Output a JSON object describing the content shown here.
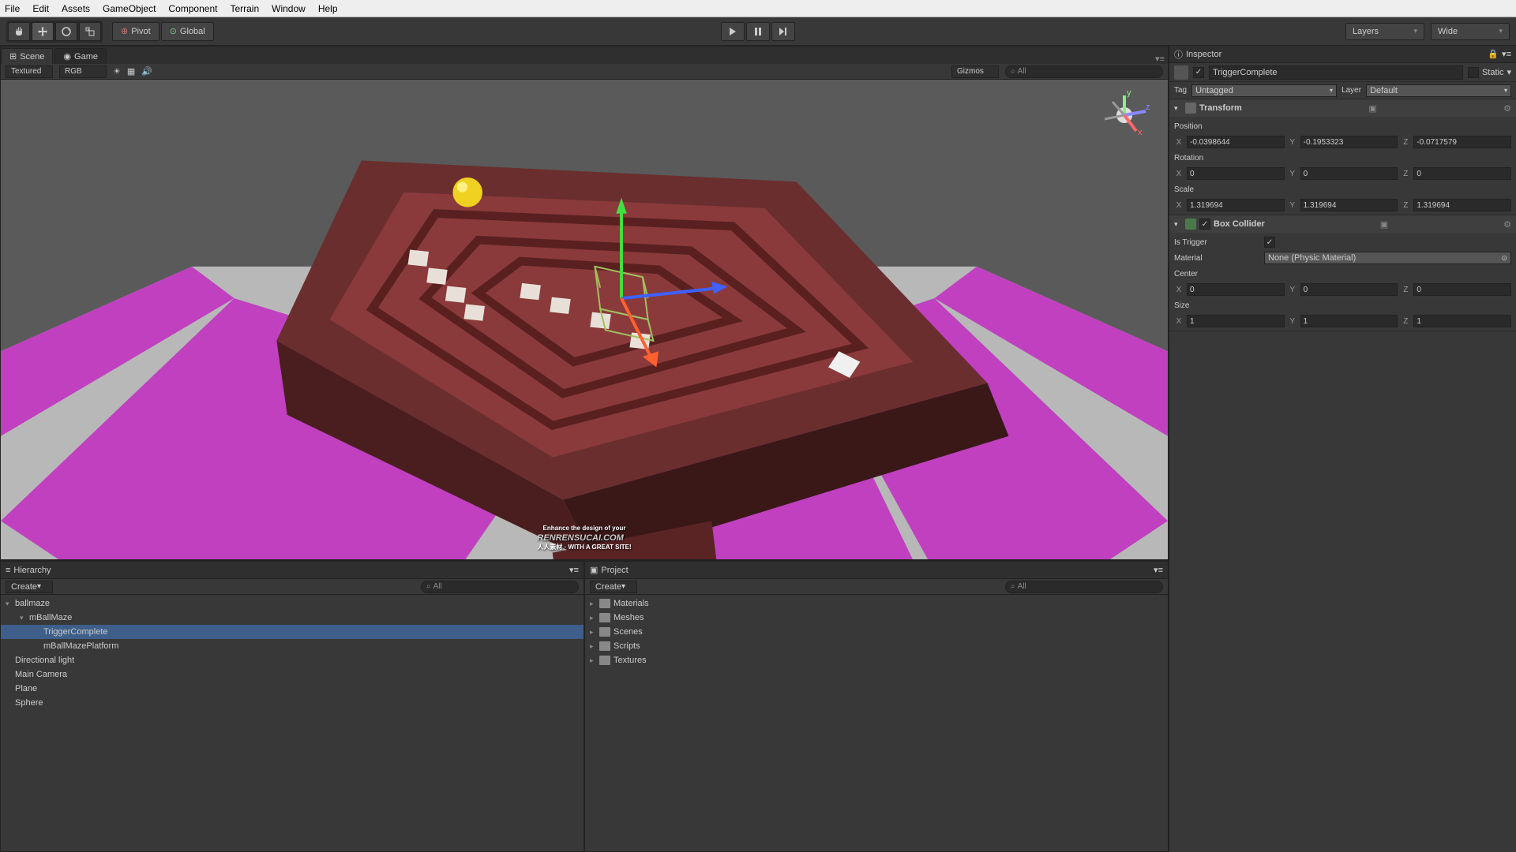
{
  "menu": [
    "File",
    "Edit",
    "Assets",
    "GameObject",
    "Component",
    "Terrain",
    "Window",
    "Help"
  ],
  "pivot": {
    "pivot": "Pivot",
    "global": "Global"
  },
  "rightDrops": {
    "layers": "Layers",
    "layout": "Wide"
  },
  "sceneTabs": {
    "scene": "Scene",
    "game": "Game"
  },
  "sceneToolbar": {
    "shading": "Textured",
    "render": "RGB",
    "gizmos": "Gizmos",
    "search": "All"
  },
  "hierarchy": {
    "title": "Hierarchy",
    "create": "Create",
    "search": "All",
    "items": [
      {
        "label": "ballmaze",
        "indent": 0,
        "arrow": "▾",
        "prefab": true
      },
      {
        "label": "mBallMaze",
        "indent": 1,
        "arrow": "▾",
        "prefab": true
      },
      {
        "label": "TriggerComplete",
        "indent": 2,
        "arrow": "",
        "selected": true
      },
      {
        "label": "mBallMazePlatform",
        "indent": 2,
        "arrow": "",
        "prefab": true
      },
      {
        "label": "Directional light",
        "indent": 0,
        "arrow": ""
      },
      {
        "label": "Main Camera",
        "indent": 0,
        "arrow": ""
      },
      {
        "label": "Plane",
        "indent": 0,
        "arrow": ""
      },
      {
        "label": "Sphere",
        "indent": 0,
        "arrow": ""
      }
    ]
  },
  "project": {
    "title": "Project",
    "create": "Create",
    "search": "All",
    "items": [
      "Materials",
      "Meshes",
      "Scenes",
      "Scripts",
      "Textures"
    ]
  },
  "inspector": {
    "title": "Inspector",
    "objectName": "TriggerComplete",
    "static": "Static",
    "tagLabel": "Tag",
    "tagValue": "Untagged",
    "layerLabel": "Layer",
    "layerValue": "Default",
    "transform": {
      "title": "Transform",
      "position": {
        "label": "Position",
        "x": "-0.0398644",
        "y": "-0.1953323",
        "z": "-0.0717579"
      },
      "rotation": {
        "label": "Rotation",
        "x": "0",
        "y": "0",
        "z": "0"
      },
      "scale": {
        "label": "Scale",
        "x": "1.319694",
        "y": "1.319694",
        "z": "1.319694"
      }
    },
    "boxCollider": {
      "title": "Box Collider",
      "isTrigger": {
        "label": "Is Trigger",
        "checked": true
      },
      "material": {
        "label": "Material",
        "value": "None (Physic Material)"
      },
      "center": {
        "label": "Center",
        "x": "0",
        "y": "0",
        "z": "0"
      },
      "size": {
        "label": "Size",
        "x": "1",
        "y": "1",
        "z": "1"
      }
    }
  },
  "watermark": {
    "main": "RENRENSUCAI.COM",
    "sub": "人人素材 · WITH A GREAT SITE!",
    "top": "Enhance the design of your"
  }
}
